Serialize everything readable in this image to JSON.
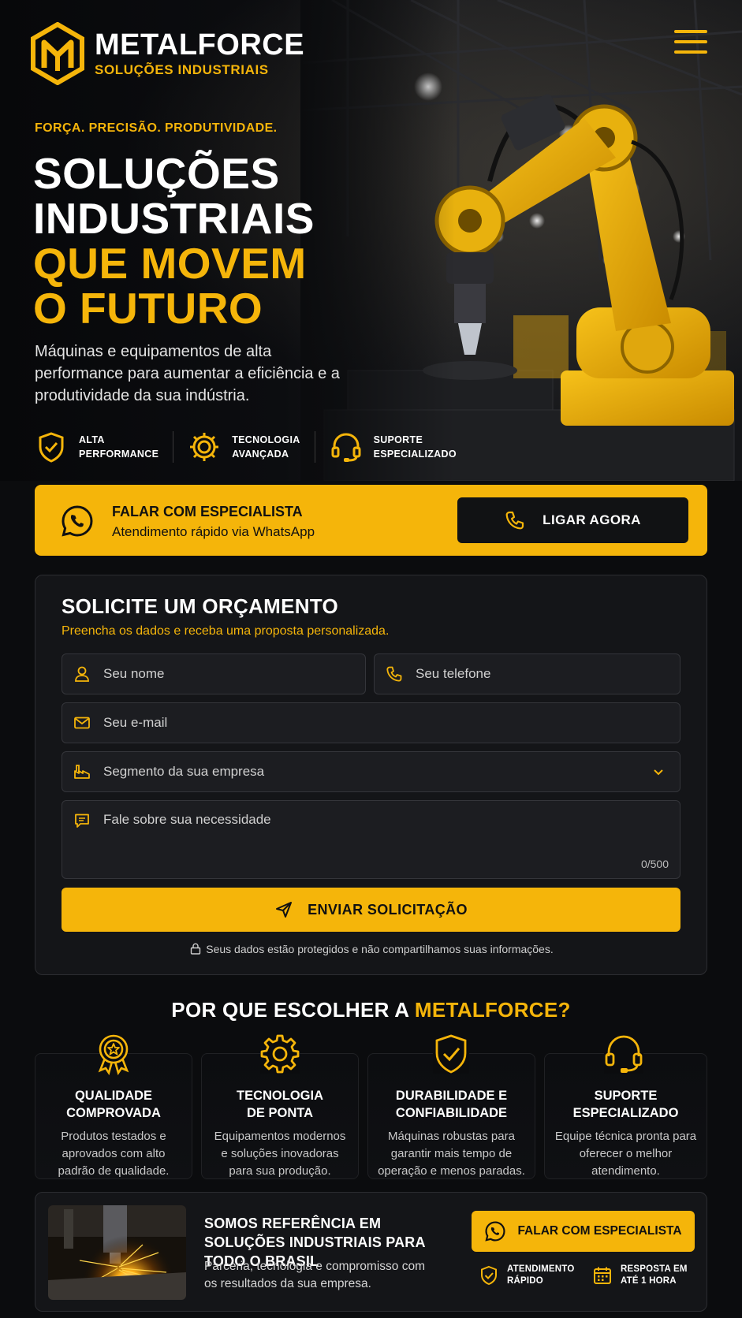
{
  "brand": {
    "name": "METALFORCE",
    "subtitle": "SOLUÇÕES INDUSTRIAIS"
  },
  "hero": {
    "tagline": "FORÇA. PRECISÃO. PRODUTIVIDADE.",
    "headline_white_1": "SOLUÇÕES",
    "headline_white_2": "INDUSTRIAIS",
    "headline_yellow_1": "QUE MOVEM",
    "headline_yellow_2": "O FUTURO",
    "lead": "Máquinas e equipamentos de alta performance para aumentar a eficiência e a produtividade da sua indústria.",
    "features": [
      {
        "line1": "ALTA",
        "line2": "PERFORMANCE",
        "icon": "shield-check-icon"
      },
      {
        "line1": "TECNOLOGIA",
        "line2": "AVANÇADA",
        "icon": "gear-icon"
      },
      {
        "line1": "SUPORTE",
        "line2": "ESPECIALIZADO",
        "icon": "headset-icon"
      }
    ]
  },
  "cta": {
    "title": "FALAR COM ESPECIALISTA",
    "subtitle": "Atendimento rápido via WhatsApp",
    "call_label": "LIGAR AGORA"
  },
  "form": {
    "title": "SOLICITE UM ORÇAMENTO",
    "subtitle": "Preencha os dados e receba uma proposta personalizada.",
    "name_placeholder": "Seu nome",
    "phone_placeholder": "Seu telefone",
    "email_placeholder": "Seu e-mail",
    "segment_placeholder": "Segmento da sua empresa",
    "message_placeholder": "Fale sobre sua necessidade",
    "counter": "0/500",
    "submit_label": "ENVIAR SOLICITAÇÃO",
    "privacy": "Seus dados estão protegidos e não compartilhamos suas informações."
  },
  "why": {
    "title_prefix": "POR QUE ESCOLHER A ",
    "title_brand": "METALFORCE?",
    "cards": [
      {
        "line1": "QUALIDADE",
        "line2": "COMPROVADA",
        "text": "Produtos testados e aprovados com alto padrão de qualidade.",
        "icon": "award-icon"
      },
      {
        "line1": "TECNOLOGIA",
        "line2": "DE PONTA",
        "text": "Equipamentos modernos e soluções inovadoras para sua produção.",
        "icon": "gear-icon"
      },
      {
        "line1": "DURABILIDADE E",
        "line2": "CONFIABILIDADE",
        "text": "Máquinas robustas para garantir mais tempo de operação e menos paradas.",
        "icon": "shield-check-icon"
      },
      {
        "line1": "SUPORTE",
        "line2": "ESPECIALIZADO",
        "text": "Equipe técnica pronta para oferecer o melhor atendimento.",
        "icon": "headset-icon"
      }
    ]
  },
  "banner": {
    "title": "SOMOS REFERÊNCIA EM SOLUÇÕES INDUSTRIAIS PARA TODO O BRASIL",
    "text": "Parceria, tecnologia e compromisso com os resultados da sua empresa.",
    "button_label": "FALAR COM ESPECIALISTA",
    "badge1_line1": "ATENDIMENTO",
    "badge1_line2": "RÁPIDO",
    "badge2_line1": "RESPOSTA EM",
    "badge2_line2": "ATÉ 1 HORA"
  },
  "colors": {
    "accent": "#f5b50a",
    "background": "#0b0c0e",
    "card": "#141518"
  }
}
